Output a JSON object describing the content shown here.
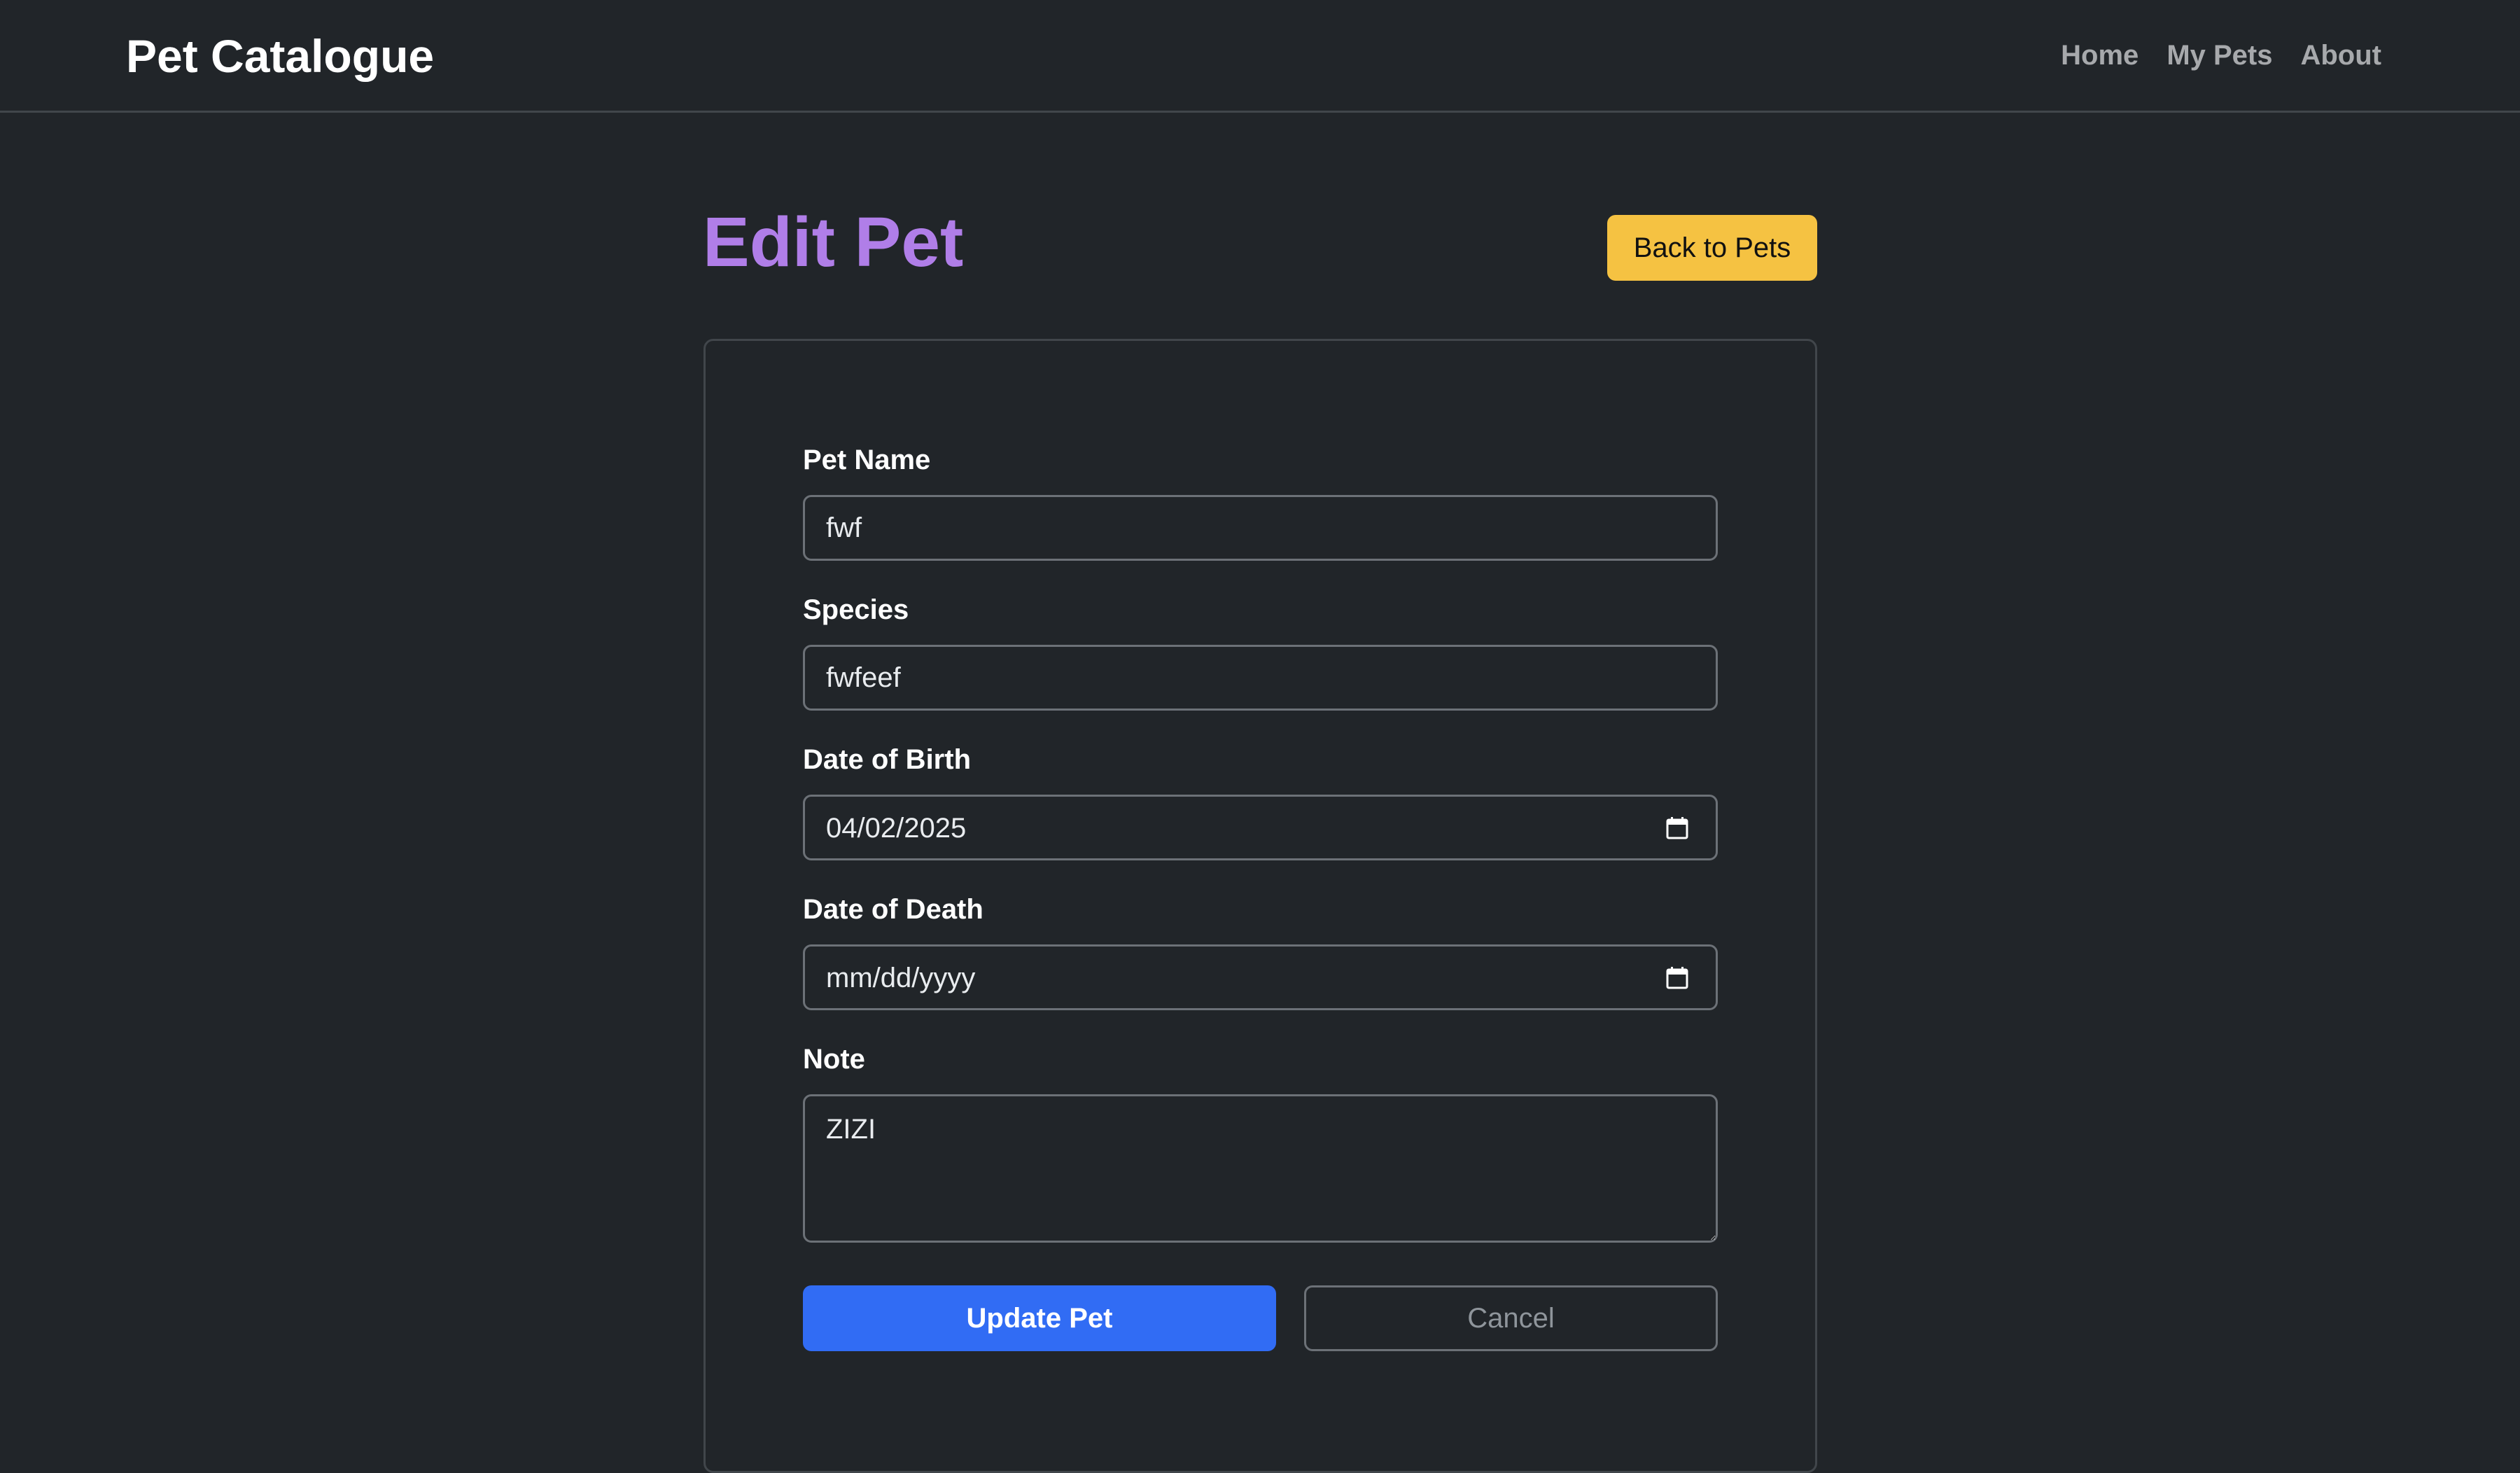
{
  "app": {
    "brand": "Pet Catalogue"
  },
  "nav": {
    "links": [
      "Home",
      "My Pets",
      "About"
    ]
  },
  "page": {
    "title": "Edit Pet",
    "back_button_label": "Back to Pets"
  },
  "form": {
    "pet_name": {
      "label": "Pet Name",
      "value": "fwf"
    },
    "species": {
      "label": "Species",
      "value": "fwfeef"
    },
    "date_of_birth": {
      "label": "Date of Birth",
      "value": "04/02/2025"
    },
    "date_of_death": {
      "label": "Date of Death",
      "placeholder": "mm/dd/yyyy"
    },
    "note": {
      "label": "Note",
      "value": "ZIZI"
    },
    "update_button_label": "Update Pet",
    "cancel_button_label": "Cancel"
  },
  "icons": {
    "calendar": "calendar-icon"
  },
  "colors": {
    "background": "#212529",
    "title_accent": "#b07ee8",
    "back_button": "#f5c242",
    "primary_button": "#316cf4",
    "border": "#6c7177"
  }
}
